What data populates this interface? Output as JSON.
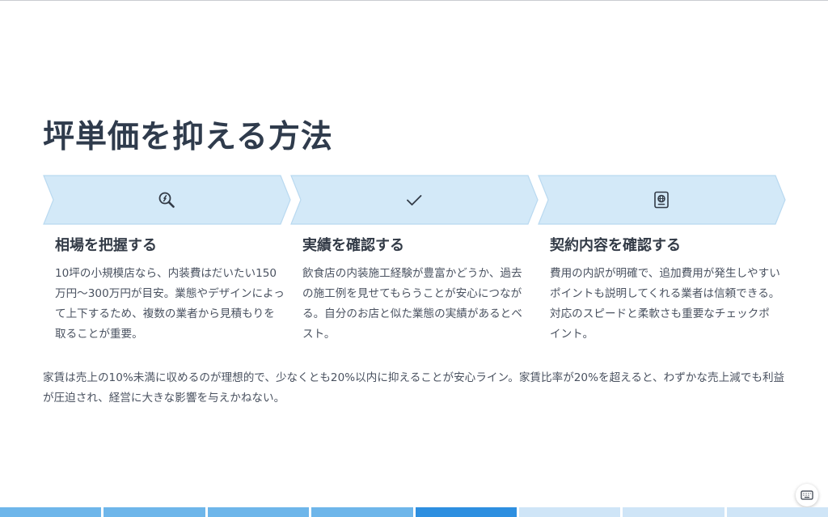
{
  "title": "坪単価を抑える方法",
  "colors": {
    "chevron_fill": "#d3e9f8",
    "chevron_stroke": "#b9d9f0",
    "icon": "#333b47",
    "progress_done": "#6eb6ea",
    "progress_current": "#2e8fe0",
    "progress_todo": "#cfe5f7"
  },
  "steps": [
    {
      "icon": "search-money-icon",
      "heading": "相場を把握する",
      "body": "10坪の小規模店なら、内装費はだいたい150万円〜300万円が目安。業態やデザインによって上下するため、複数の業者から見積もりを取ることが重要。"
    },
    {
      "icon": "checkmark-icon",
      "heading": "実績を確認する",
      "body": "飲食店の内装施工経験が豊富かどうか、過去の施工例を見せてもらうことが安心につながる。自分のお店と似た業態の実績があるとベスト。"
    },
    {
      "icon": "passport-icon",
      "heading": "契約内容を確認する",
      "body": "費用の内訳が明確で、追加費用が発生しやすいポイントも説明してくれる業者は信頼できる。対応のスピードと柔軟さも重要なチェックポイント。"
    }
  ],
  "summary": "家賃は売上の10%未満に収めるのが理想的で、少なくとも20%以内に抑えることが安心ライン。家賃比率が20%を超えると、わずかな売上減でも利益が圧迫され、経営に大きな影響を与えかねない。",
  "keyboard_button": {
    "icon": "keyboard-icon"
  },
  "progress": {
    "total_slides": 8,
    "current_slide": 5
  }
}
